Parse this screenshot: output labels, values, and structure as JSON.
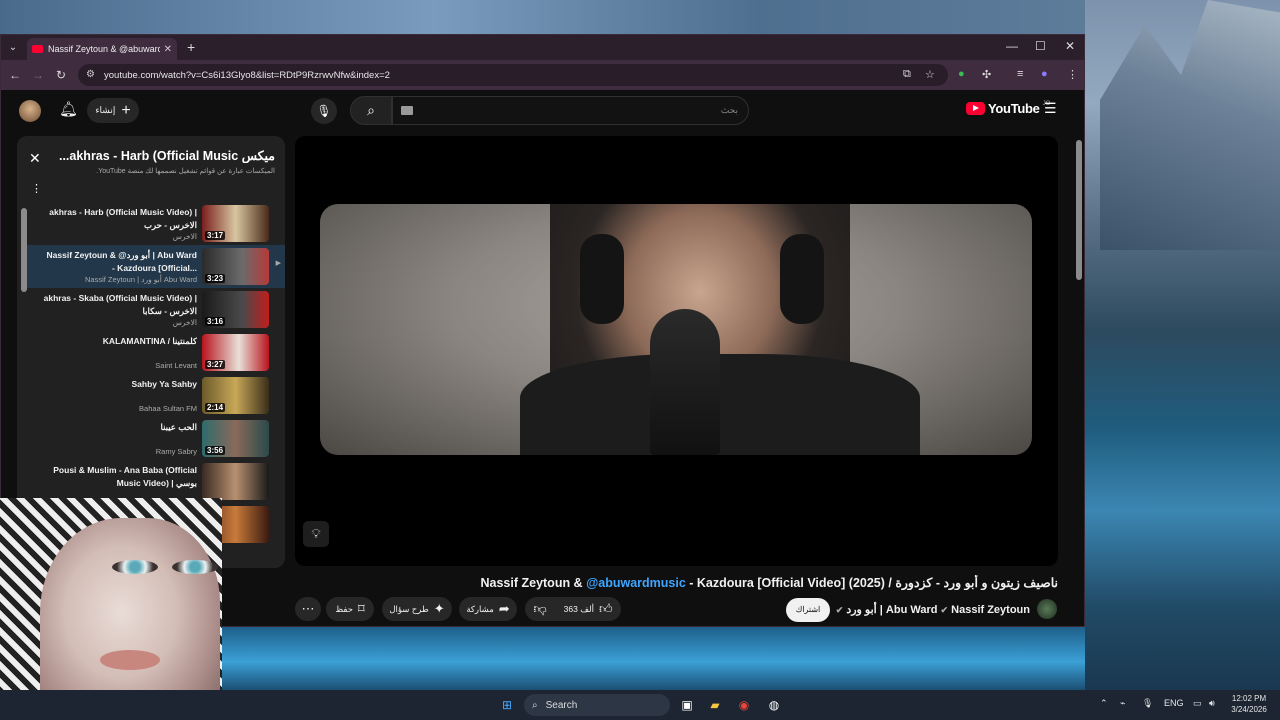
{
  "browser": {
    "tab_title": "Nassif Zeytoun & @abuwardmusic",
    "url": "youtube.com/watch?v=Cs6i13Glyo8&list=RDtP9RzrwvNfw&index=2"
  },
  "youtube": {
    "create_label": "إنشاء",
    "search_placeholder": "بحث",
    "logo_text": "YouTube",
    "logo_region": "JO"
  },
  "playlist": {
    "title": "ميكس akhras - Harb (Official Music...",
    "subtitle": "الميكسات عبارة عن قوائم تشغيل نصممها لك منصة YouTube.",
    "items": [
      {
        "title": "akhras - Harb (Official Music Video) | الاخرس - حرب",
        "channel": "الاخرس",
        "duration": "3:17",
        "indicator": ""
      },
      {
        "title": "Nassif Zeytoun & @أبو ورد | Abu Ward - Kazdoura [Official...",
        "channel": "Nassif Zeytoun | أبو ورد Abu Ward",
        "duration": "3:23",
        "indicator": "▶"
      },
      {
        "title": "akhras - Skaba (Official Music Video) | الاخرس - سكابا",
        "channel": "الاخرس",
        "duration": "3:16",
        "indicator": ""
      },
      {
        "title": "KALAMANTINA / كلمنتينا",
        "channel": "Saint Levant",
        "duration": "3:27",
        "indicator": ""
      },
      {
        "title": "Sahby Ya Sahby",
        "channel": "Bahaa Sultan FM",
        "duration": "2:14",
        "indicator": ""
      },
      {
        "title": "الحب عيبنا",
        "channel": "Ramy Sabry",
        "duration": "3:56",
        "indicator": ""
      },
      {
        "title": "Pousi & Muslim - Ana Baba (Official Music Video) | بوسي",
        "channel": "",
        "duration": "",
        "indicator": ""
      },
      {
        "title": "",
        "channel": "",
        "duration": "",
        "indicator": ""
      }
    ]
  },
  "video": {
    "title_pre": "ناصيف زيتون و أبو ورد - كزدورة / (2025) Nassif Zeytoun & ",
    "title_mention": "@abuwardmusic",
    "title_post": " - Kazdoura [Official Video]",
    "channel": "Nassif Zeytoun",
    "channel_second": "أبو ورد | Abu Ward",
    "subscribe_label": "اشتراك",
    "likes": "363 ألف",
    "share_label": "مشاركة",
    "ask_label": "طرح سؤال",
    "save_label": "حفظ"
  },
  "taskbar": {
    "search_label": "Search",
    "language": "ENG",
    "time": "12:02 PM",
    "date": "3/24/2026"
  },
  "colors": {
    "youtube_red": "#ff0033",
    "link_blue": "#3ea6ff",
    "background": "#0f0f0f"
  }
}
